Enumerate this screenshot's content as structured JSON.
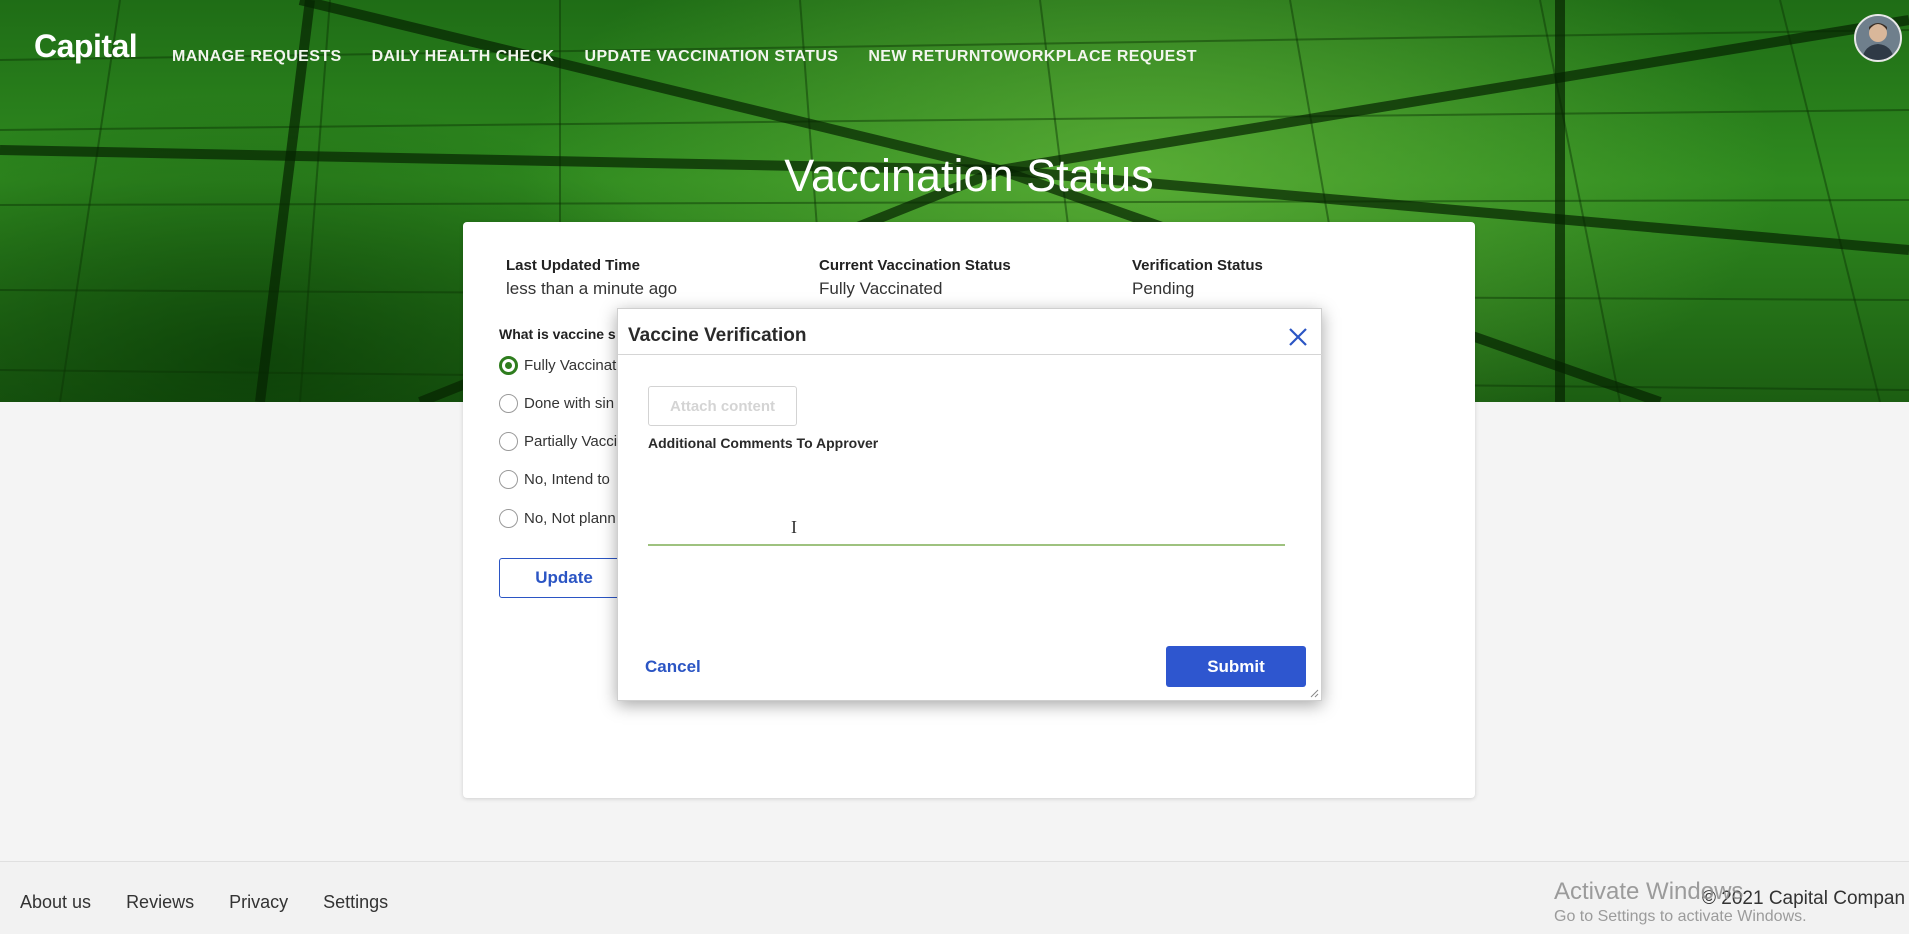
{
  "header": {
    "logo": "Capital",
    "nav": [
      {
        "label": "MANAGE REQUESTS"
      },
      {
        "label": "DAILY HEALTH CHECK"
      },
      {
        "label": "UPDATE VACCINATION STATUS"
      },
      {
        "label": "NEW RETURNTOWORKPLACE REQUEST"
      }
    ]
  },
  "page": {
    "title": "Vaccination Status"
  },
  "status": {
    "last_updated_label": "Last Updated Time",
    "last_updated_value": "less than a minute ago",
    "current_label": "Current Vaccination Status",
    "current_value": "Fully Vaccinated",
    "verification_label": "Verification Status",
    "verification_value": "Pending"
  },
  "form": {
    "question": "What is vaccine s",
    "options": [
      {
        "label": "Fully Vaccinat",
        "selected": true
      },
      {
        "label": "Done with sin",
        "selected": false
      },
      {
        "label": "Partially Vacci",
        "selected": false
      },
      {
        "label": "No, Intend to",
        "selected": false
      },
      {
        "label": "No, Not plann",
        "selected": false
      }
    ],
    "update_label": "Update"
  },
  "modal": {
    "title": "Vaccine Verification",
    "attach_label": "Attach content",
    "comments_label": "Additional Comments To Approver",
    "comments_value": "",
    "cancel_label": "Cancel",
    "submit_label": "Submit",
    "text_cursor": "I"
  },
  "footer": {
    "links": [
      "About us",
      "Reviews",
      "Privacy",
      "Settings"
    ],
    "copyright": "© 2021 Capital Compan"
  },
  "watermark": {
    "line1": "Activate Windows",
    "line2": "Go to Settings to activate Windows."
  },
  "colors": {
    "accent_blue": "#2e56cf",
    "brand_green": "#2e7d1e"
  }
}
